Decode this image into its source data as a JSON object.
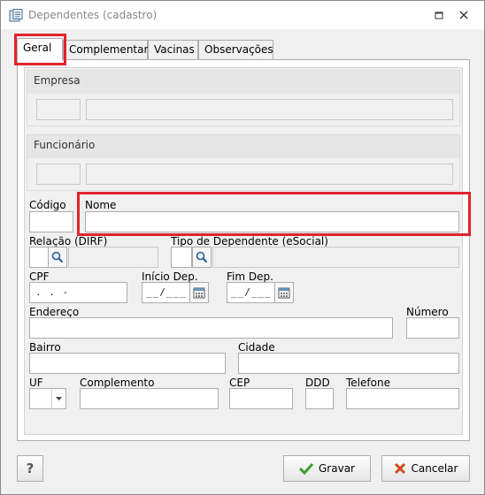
{
  "window": {
    "title": "Dependentes (cadastro)"
  },
  "tabs": [
    "Geral",
    "Complementar",
    "Vacinas",
    "Observações"
  ],
  "groups": {
    "empresa": "Empresa",
    "funcionario": "Funcionário"
  },
  "labels": {
    "codigo": "Código",
    "nome": "Nome",
    "relacao": "Relação (DIRF)",
    "tipo_dependente": "Tipo de Dependente (eSocial)",
    "cpf": "CPF",
    "inicio_dep": "Início Dep.",
    "fim_dep": "Fim Dep.",
    "endereco": "Endereço",
    "numero": "Número",
    "bairro": "Bairro",
    "cidade": "Cidade",
    "uf": "UF",
    "complemento": "Complemento",
    "cep": "CEP",
    "ddd": "DDD",
    "telefone": "Telefone"
  },
  "values": {
    "cpf": ".  .   -",
    "inicio_dep": "__/___",
    "fim_dep": "__/___"
  },
  "buttons": {
    "help": "?",
    "gravar": "Gravar",
    "cancelar": "Cancelar"
  },
  "colors": {
    "highlight": "#e0242c",
    "gravar_icon": "#3aa12a",
    "cancelar_icon": "#d04a1a",
    "search_icon": "#2a5a9a"
  },
  "icons": [
    "app-icon",
    "restore-icon",
    "close-icon",
    "search-icon",
    "calendar-icon",
    "dropdown-arrow-icon",
    "help-icon",
    "check-icon",
    "x-icon"
  ]
}
